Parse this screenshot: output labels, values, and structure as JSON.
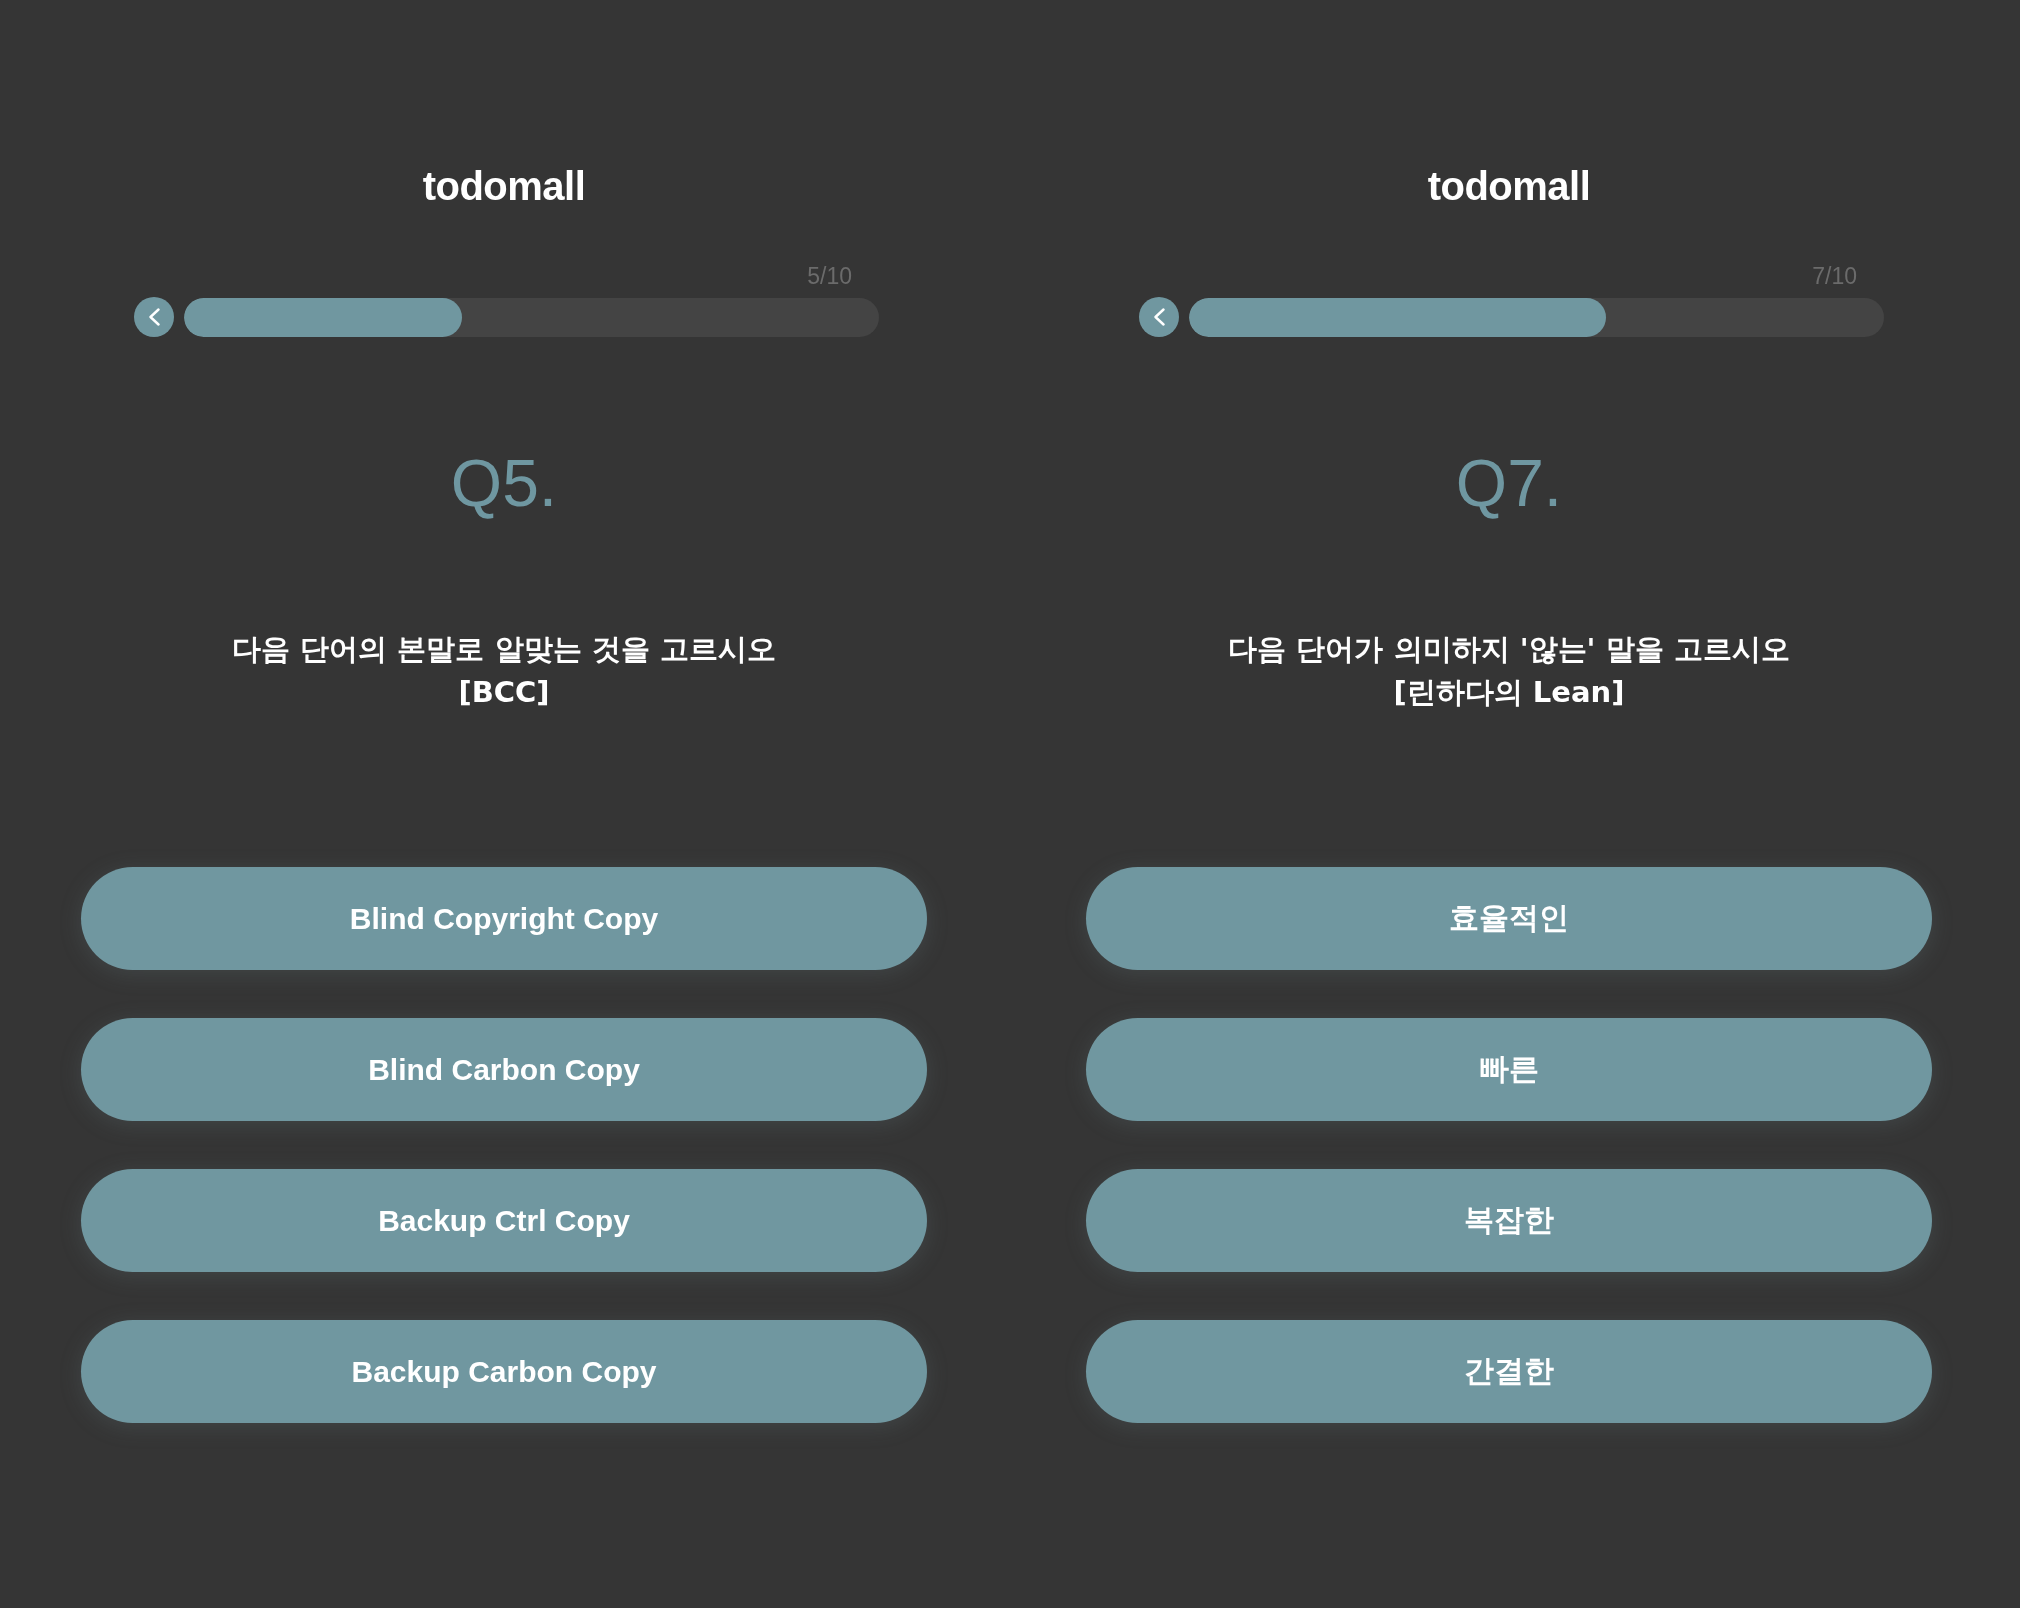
{
  "screens": [
    {
      "logo": "todomall",
      "counter": "5/10",
      "progress": {
        "level": 0.4
      },
      "question_number": "Q5.",
      "prompt": "다음 단어의 본말로 알맞는 것을 고르시오",
      "term": "[BCC]",
      "options": [
        {
          "label": "Blind Copyright Copy"
        },
        {
          "label": "Blind Carbon Copy"
        },
        {
          "label": "Backup Ctrl Copy"
        },
        {
          "label": "Backup Carbon Copy"
        }
      ]
    },
    {
      "logo": "todomall",
      "counter": "7/10",
      "progress": {
        "level": 0.6
      },
      "question_number": "Q7.",
      "prompt": "다음 단어가 의미하지 '않는' 말을 고르시오",
      "term": "[린하다의 Lean]",
      "options": [
        {
          "label": "효율적인"
        },
        {
          "label": "빠른"
        },
        {
          "label": "복잡한"
        },
        {
          "label": "간결한"
        }
      ]
    }
  ]
}
